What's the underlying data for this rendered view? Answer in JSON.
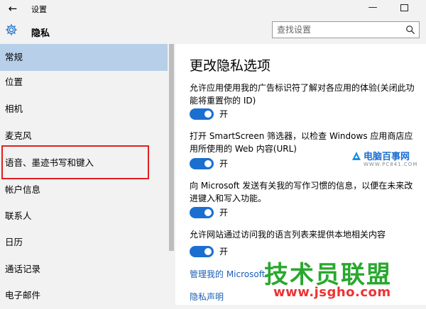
{
  "window": {
    "back_glyph": "←",
    "title": "设置",
    "minimize_glyph": "—"
  },
  "header": {
    "icon": "gear-icon",
    "section_title": "隐私",
    "search": {
      "placeholder": "查找设置",
      "icon": "search-icon"
    }
  },
  "sidebar": {
    "items": [
      {
        "label": "常规",
        "selected": true
      },
      {
        "label": "位置"
      },
      {
        "label": "相机"
      },
      {
        "label": "麦克风"
      },
      {
        "label": "语音、墨迹书写和键入",
        "highlighted": true
      },
      {
        "label": "帐户信息"
      },
      {
        "label": "联系人"
      },
      {
        "label": "日历"
      },
      {
        "label": "通话记录"
      },
      {
        "label": "电子邮件"
      }
    ]
  },
  "main": {
    "title": "更改隐私选项",
    "settings": [
      {
        "description": "允许应用使用我的广告标识符了解对各应用的体验(关闭此功能将重置你的 ID)",
        "state": "开",
        "on": true
      },
      {
        "description": "打开 SmartScreen 筛选器，以检查 Windows 应用商店应用所使用的 Web 内容(URL)",
        "state": "开",
        "on": true
      },
      {
        "description": "向 Microsoft 发送有关我的写作习惯的信息，以便在未来改进键入和写入功能。",
        "state": "开",
        "on": true
      },
      {
        "description": "允许网站通过访问我的语言列表来提供本地相关内容",
        "state": "开",
        "on": true
      }
    ],
    "links": [
      "管理我的 Microsoft",
      "隐私声明"
    ]
  },
  "watermarks": {
    "logo_text": "电脑百事网",
    "logo_sub": "WWW.PC841.COM",
    "big_text": "技术员联盟",
    "url_text": "www.jsgho.com"
  },
  "colors": {
    "accent": "#1a6fd0",
    "selected_bg": "#b7cfe8",
    "highlight_border": "#e02020",
    "link": "#1a5fb4"
  }
}
